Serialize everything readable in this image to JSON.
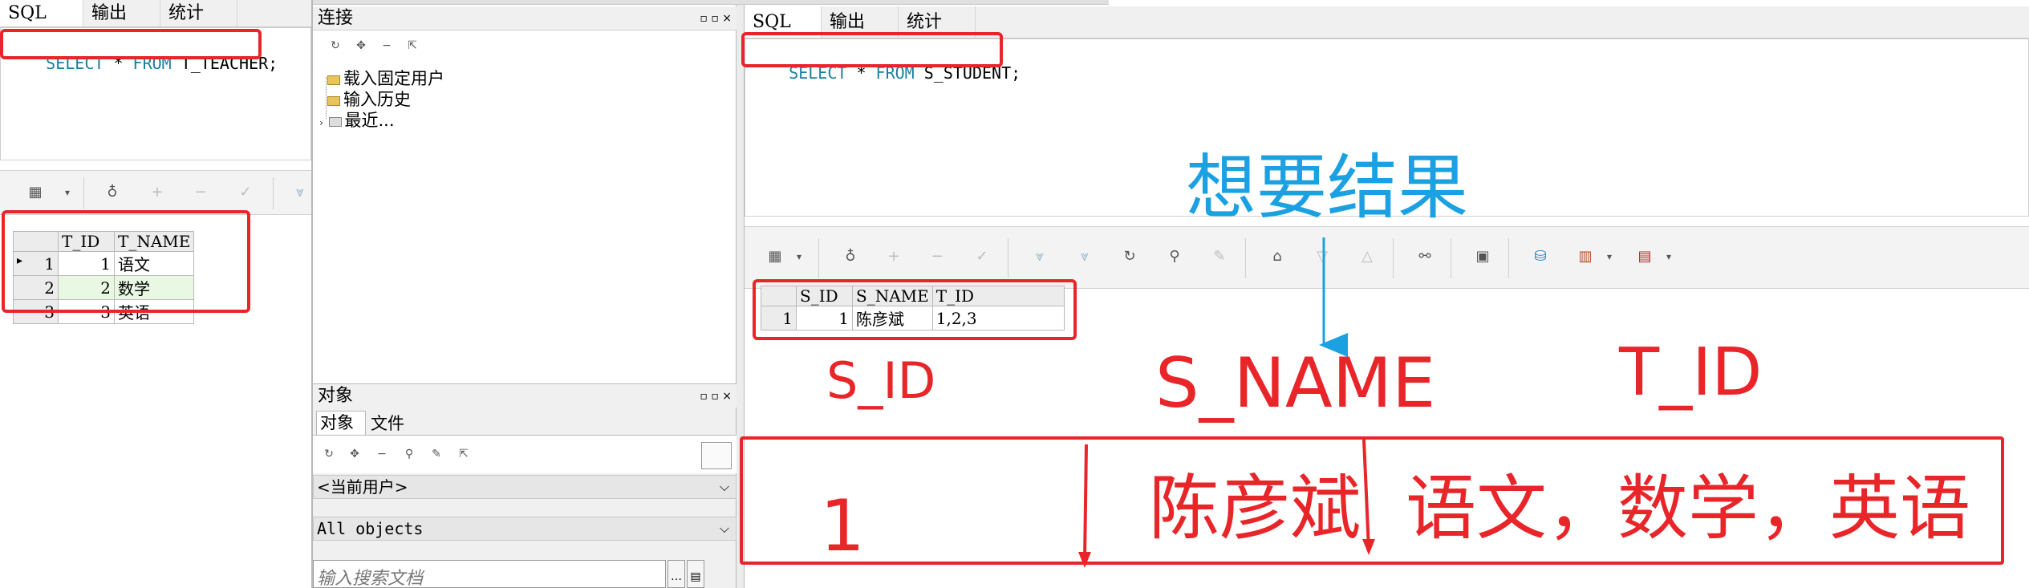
{
  "left_panel": {
    "tabs": [
      "SQL",
      "输出",
      "统计"
    ],
    "sql": {
      "keyword1": "SELECT",
      "op": " * ",
      "keyword2": "FROM",
      "rest": " T_TEACHER;"
    },
    "grid": {
      "headers": [
        "T_ID",
        "T_NAME"
      ],
      "rows": [
        {
          "rn": "1",
          "id": "1",
          "name": "语文"
        },
        {
          "rn": "2",
          "id": "2",
          "name": "数学"
        },
        {
          "rn": "3",
          "id": "3",
          "name": "英语"
        }
      ]
    }
  },
  "connection_panel": {
    "title": "连接",
    "window_controls": "▫ ▫ ×",
    "tree": [
      "载入固定用户",
      "输入历史",
      "最近..."
    ]
  },
  "object_panel": {
    "title": "对象",
    "window_controls": "▫ ▫ ×",
    "tabs": [
      "对象",
      "文件"
    ],
    "user_select": "<当前用户>",
    "objects_select": "All objects",
    "search_placeholder": "输入搜索文档"
  },
  "right_panel": {
    "tabs": [
      "SQL",
      "输出",
      "统计"
    ],
    "sql": {
      "keyword1": "SELECT",
      "op": " * ",
      "keyword2": "FROM",
      "rest": " S_STUDENT;"
    },
    "grid": {
      "headers": [
        "S_ID",
        "S_NAME",
        "T_ID"
      ],
      "rows": [
        {
          "rn": "1",
          "id": "1",
          "name": "陈彦斌",
          "tid": "1,2,3"
        }
      ]
    }
  },
  "annotations": {
    "want_result": "想要结果",
    "col_sid": "S_ID",
    "col_sname": "S_NAME",
    "col_tid": "T_ID",
    "val_id": "1",
    "val_name": "陈彦斌",
    "val_subjects": "语文，数学，英语"
  },
  "colors": {
    "annotation_red": "#e8262a",
    "annotation_blue": "#1ba1e2",
    "sql_keyword": "#1a7fa0"
  }
}
